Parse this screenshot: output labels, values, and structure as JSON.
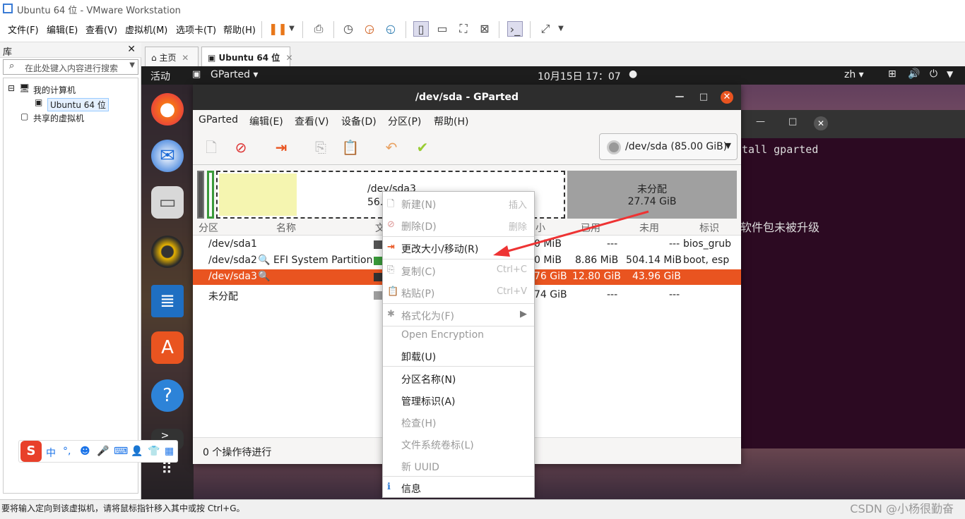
{
  "vmware": {
    "title": "Ubuntu 64 位 - VMware Workstation",
    "menu": [
      "文件(F)",
      "编辑(E)",
      "查看(V)",
      "虚拟机(M)",
      "选项卡(T)",
      "帮助(H)"
    ],
    "library": {
      "title": "库",
      "search_placeholder": "在此处键入内容进行搜索",
      "tree": [
        "我的计算机",
        "Ubuntu 64 位",
        "共享的虚拟机"
      ]
    },
    "tabs": [
      "主页",
      "Ubuntu 64 位"
    ],
    "status": "要将输入定向到该虚拟机，请将鼠标指针移入其中或按 Ctrl+G。",
    "watermark": "CSDN @小杨很勤奋"
  },
  "ubuntu": {
    "activities": "活动",
    "app_menu": "GParted ▾",
    "clock": "10月15日  17：07",
    "lang": "zh ▾",
    "terminal_lines": [
      "tall gparted",
      "软件包未被升级"
    ]
  },
  "gparted": {
    "title": "/dev/sda - GParted",
    "menu": [
      "GParted",
      "编辑(E)",
      "查看(V)",
      "设备(D)",
      "分区(P)",
      "帮助(H)"
    ],
    "device": "/dev/sda (85.00 GiB)",
    "map": {
      "sda3_label": "/dev/sda3",
      "sda3_size": "56.",
      "unalloc_label": "未分配",
      "unalloc_size": "27.74 GiB"
    },
    "columns": [
      "分区",
      "名称",
      "文",
      "小",
      "已用",
      "未用",
      "标识"
    ],
    "rows": [
      {
        "part": "/dev/sda1",
        "name": "",
        "size": "0 MiB",
        "used": "---",
        "unused": "---",
        "flags": "bios_grub"
      },
      {
        "part": "/dev/sda2",
        "name": "EFI System Partition",
        "size": "0 MiB",
        "used": "8.86 MiB",
        "unused": "504.14 MiB",
        "flags": "boot, esp"
      },
      {
        "part": "/dev/sda3",
        "name": "",
        "size": "76 GiB",
        "used": "12.80 GiB",
        "unused": "43.96 GiB",
        "flags": ""
      },
      {
        "part": "未分配",
        "name": "",
        "size": "74 GiB",
        "used": "---",
        "unused": "---",
        "flags": ""
      }
    ],
    "status": "0 个操作待进行"
  },
  "context_menu": {
    "new": "新建(N)",
    "new_acc": "插入",
    "delete": "删除(D)",
    "delete_acc": "删除",
    "resize": "更改大小/移动(R)",
    "copy": "复制(C)",
    "copy_acc": "Ctrl+C",
    "paste": "粘贴(P)",
    "paste_acc": "Ctrl+V",
    "format": "格式化为(F)",
    "open_encryption": "Open Encryption",
    "unmount": "卸载(U)",
    "name": "分区名称(N)",
    "flags": "管理标识(A)",
    "check": "检查(H)",
    "label": "文件系统卷标(L)",
    "uuid": "新 UUID",
    "info": "信息"
  },
  "ime": {
    "lang": "中"
  },
  "colors": {
    "accent": "#e95420",
    "sda3": "#f5f5b0",
    "unalloc": "#a0a0a0"
  }
}
